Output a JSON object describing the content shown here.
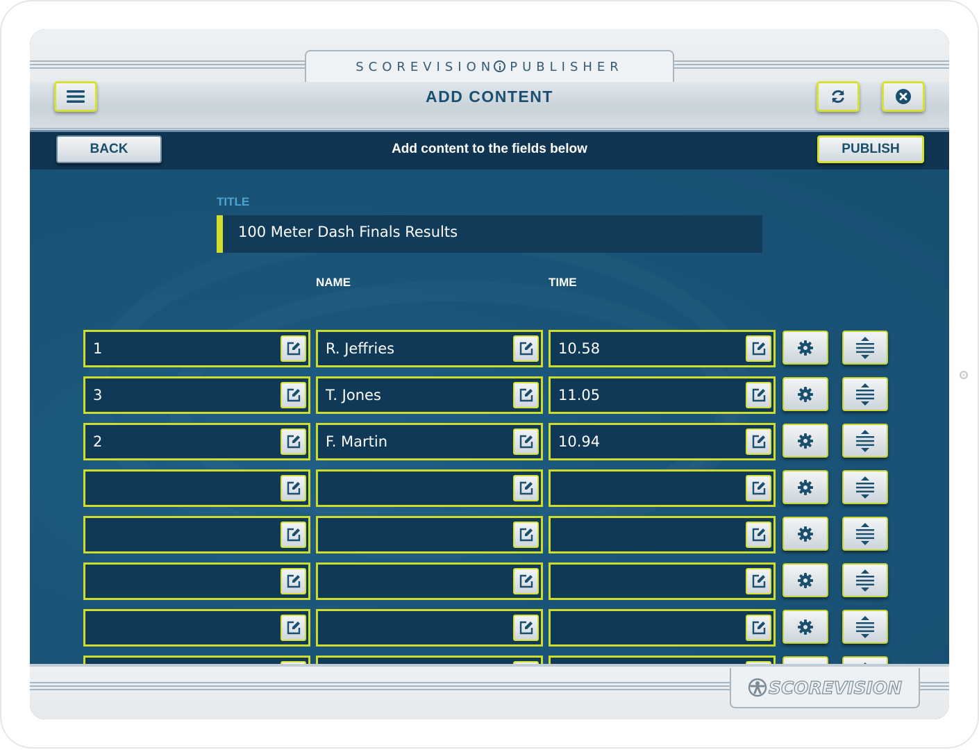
{
  "brand": {
    "left": "SCOREVISION",
    "right": "PUBLISHER"
  },
  "header": {
    "title": "ADD CONTENT"
  },
  "actionbar": {
    "back_label": "BACK",
    "instructions": "Add content to the fields below",
    "publish_label": "PUBLISH"
  },
  "form": {
    "title_label": "TITLE",
    "title_value": "100 Meter Dash Finals Results",
    "columns": [
      "",
      "NAME",
      "TIME"
    ],
    "rows": [
      [
        "1",
        "R. Jeffries",
        "10.58"
      ],
      [
        "3",
        "T. Jones",
        "11.05"
      ],
      [
        "2",
        "F. Martin",
        "10.94"
      ],
      [
        "",
        "",
        ""
      ],
      [
        "",
        "",
        ""
      ],
      [
        "",
        "",
        ""
      ],
      [
        "",
        "",
        ""
      ],
      [
        "",
        "",
        ""
      ]
    ]
  },
  "footer": {
    "logo_text": "SCOREVISION"
  },
  "colors": {
    "accent": "#d1df2c",
    "panel": "#1a5477",
    "dark": "#0f3552",
    "label_blue": "#4fa3d1",
    "title_text": "#1b4f70"
  },
  "icons": [
    "menu-icon",
    "refresh-icon",
    "close-icon",
    "edit-icon",
    "gear-icon",
    "reorder-icon"
  ]
}
